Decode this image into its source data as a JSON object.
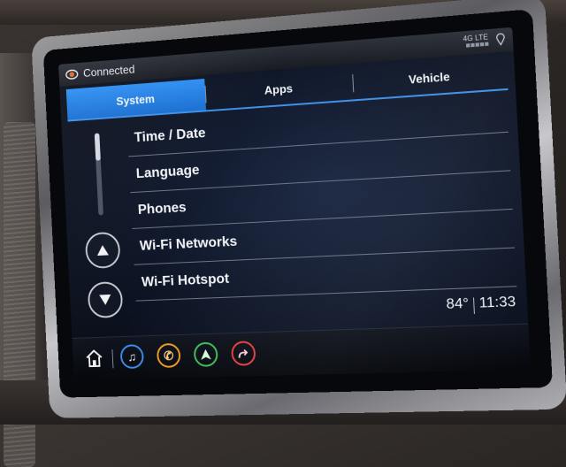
{
  "status": {
    "connection_label": "Connected",
    "network_label": "4G LTE",
    "connection_icon": "connected-icon",
    "location_icon": "location-pin-icon"
  },
  "tabs": [
    {
      "label": "System",
      "active": true
    },
    {
      "label": "Apps",
      "active": false
    },
    {
      "label": "Vehicle",
      "active": false
    }
  ],
  "list": {
    "items": [
      "Time / Date",
      "Language",
      "Phones",
      "Wi-Fi Networks",
      "Wi-Fi Hotspot"
    ]
  },
  "scroll": {
    "up_icon": "arrow-up-icon",
    "down_icon": "arrow-down-icon"
  },
  "info": {
    "temperature": "84°",
    "time": "11:33"
  },
  "dock": {
    "home_icon": "home-icon",
    "apps": [
      {
        "icon": "music-note-icon",
        "color": "#3e8ef0"
      },
      {
        "icon": "phone-icon",
        "color": "#f0a020"
      },
      {
        "icon": "navigation-icon",
        "color": "#3fc05a"
      },
      {
        "icon": "route-icon",
        "color": "#e84040"
      }
    ]
  },
  "colors": {
    "accent": "#2f8ff3",
    "background": "#0d1424",
    "text": "#f3f5f9"
  }
}
